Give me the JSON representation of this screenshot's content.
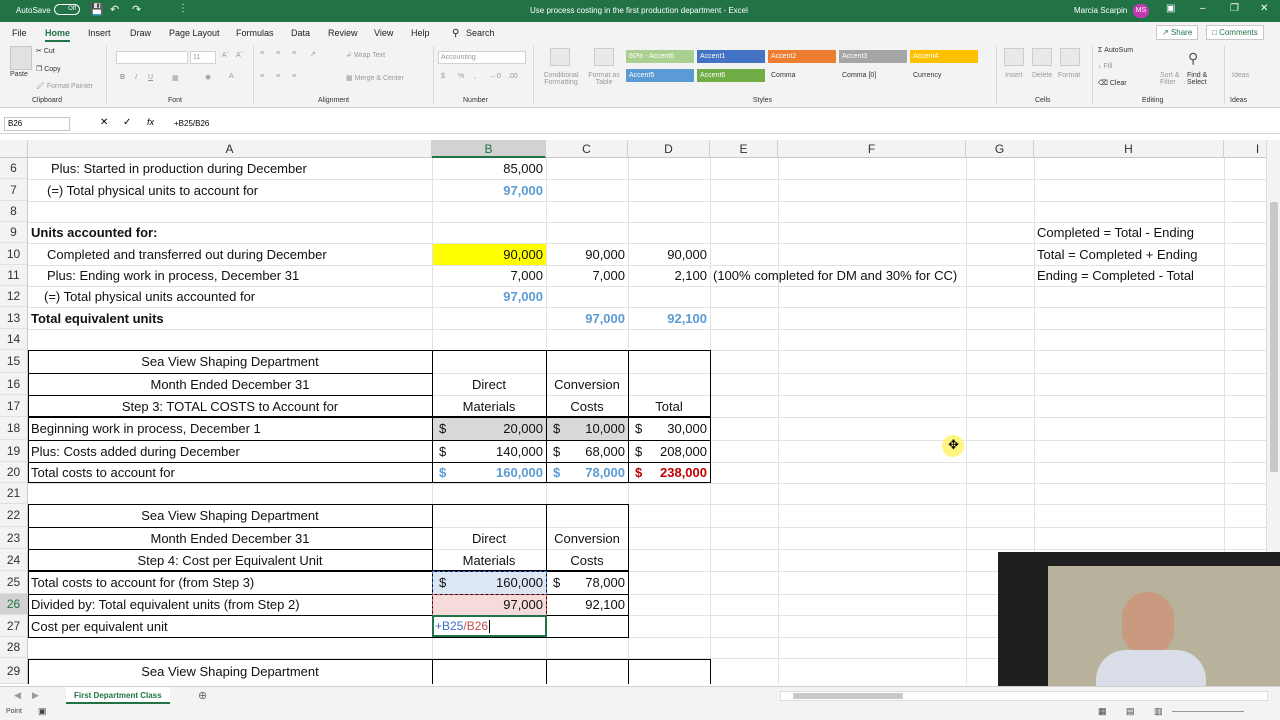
{
  "titlebar": {
    "autosave": "AutoSave",
    "autosave_state": "Off",
    "title": "Use process costing in the first production department  -  Excel",
    "user": "Marcia Scarpin",
    "initials": "MS"
  },
  "tabs": [
    "File",
    "Home",
    "Insert",
    "Draw",
    "Page Layout",
    "Formulas",
    "Data",
    "Review",
    "View",
    "Help"
  ],
  "search": "Search",
  "share": "Share",
  "comments": "Comments",
  "ribbon": {
    "groups": [
      "Clipboard",
      "Font",
      "Alignment",
      "Number",
      "Styles",
      "Cells",
      "Editing",
      "Ideas"
    ],
    "paste": "Paste",
    "cut": "Cut",
    "copy": "Copy",
    "format_painter": "Format Painter",
    "font_size": "11",
    "wrap": "Wrap Text",
    "merge": "Merge & Center",
    "numfmt": "Accounting",
    "cond": "Conditional Formatting",
    "format_as": "Format as Table",
    "styles": [
      "60% - Accent6",
      "Accent1",
      "Accent2",
      "Accent3",
      "Accent4",
      "Accent5",
      "Accent6",
      "Comma",
      "Comma [0]",
      "Currency"
    ],
    "cells": [
      "Insert",
      "Delete",
      "Format"
    ],
    "autosum": "AutoSum",
    "fill": "Fill",
    "clear": "Clear",
    "sort": "Sort & Filter",
    "find": "Find & Select",
    "ideas": "Ideas"
  },
  "formula_bar": {
    "namebox": "B26",
    "formula": "+B25/B26"
  },
  "columns": [
    "A",
    "B",
    "C",
    "D",
    "E",
    "F",
    "G",
    "H",
    "I"
  ],
  "rows": [
    "6",
    "7",
    "8",
    "9",
    "10",
    "11",
    "12",
    "13",
    "14",
    "15",
    "16",
    "17",
    "18",
    "19",
    "20",
    "21",
    "22",
    "23",
    "24",
    "25",
    "26",
    "27",
    "28",
    "29"
  ],
  "cells": {
    "a6": "Plus: Started in production during December",
    "b6": "85,000",
    "a7": "(=) Total physical units to account for",
    "b7": "97,000",
    "a9": "Units accounted for:",
    "a10": "Completed and transferred out during December",
    "b10": "90,000",
    "c10": "90,000",
    "d10": "90,000",
    "a11": "Plus: Ending work in process, December 31",
    "b11": "7,000",
    "c11": "7,000",
    "d11": "2,100",
    "e11": "(100% completed for DM and 30% for CC)",
    "a12": "(=) Total physical units accounted for",
    "b12": "97,000",
    "a13": "Total equivalent units",
    "c13": "97,000",
    "d13": "92,100",
    "h9": "Completed = Total - Ending",
    "h10": "Total = Completed + Ending",
    "h11": "Ending = Completed - Total",
    "a15": "Sea View Shaping Department",
    "a16": "Month Ended December 31",
    "a17": "Step 3: TOTAL COSTS to Account for",
    "b16": "Direct",
    "b17": "Materials",
    "c16": "Conversion",
    "c17": "Costs",
    "d17": "Total",
    "a18": "Beginning work in process, December 1",
    "b18": "20,000",
    "c18": "10,000",
    "d18": "30,000",
    "a19": "Plus: Costs added during December",
    "b19": "140,000",
    "c19": "68,000",
    "d19": "208,000",
    "a20": "Total costs to account for",
    "b20": "160,000",
    "c20": "78,000",
    "d20": "238,000",
    "a22": "Sea View Shaping Department",
    "a23": "Month Ended December 31",
    "a24": "Step 4: Cost per Equivalent Unit",
    "b23": "Direct",
    "b24": "Materials",
    "c23": "Conversion",
    "c24": "Costs",
    "a25": "Total costs to account for (from Step 3)",
    "b25": "160,000",
    "c25": "78,000",
    "a26": "Divided by: Total equivalent units (from Step 2)",
    "b26": "97,000",
    "c26": "92,100",
    "a27": "Cost per equivalent unit",
    "b27_ref1": "+B25",
    "b27_ref2": "/B26",
    "a29": "Sea View Shaping Department",
    "dollar": "$"
  },
  "sheet_tab": "First Department Class",
  "status": "Point",
  "colors": {
    "excel_green": "#217346",
    "blue_num": "#5b9bd5",
    "red_num": "#c00000",
    "yellow": "#ffff00",
    "grey_fill": "#d9d9d9"
  }
}
